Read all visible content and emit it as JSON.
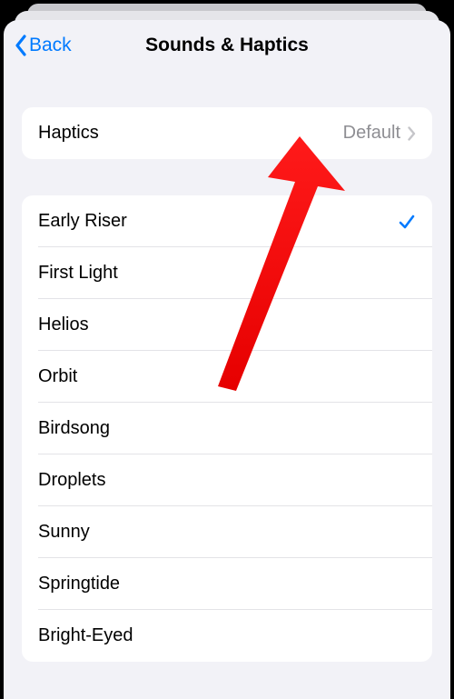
{
  "nav": {
    "back_label": "Back",
    "title": "Sounds & Haptics"
  },
  "haptics_row": {
    "label": "Haptics",
    "value": "Default"
  },
  "sounds": [
    {
      "label": "Early Riser",
      "selected": true
    },
    {
      "label": "First Light",
      "selected": false
    },
    {
      "label": "Helios",
      "selected": false
    },
    {
      "label": "Orbit",
      "selected": false
    },
    {
      "label": "Birdsong",
      "selected": false
    },
    {
      "label": "Droplets",
      "selected": false
    },
    {
      "label": "Sunny",
      "selected": false
    },
    {
      "label": "Springtide",
      "selected": false
    },
    {
      "label": "Bright-Eyed",
      "selected": false
    }
  ]
}
